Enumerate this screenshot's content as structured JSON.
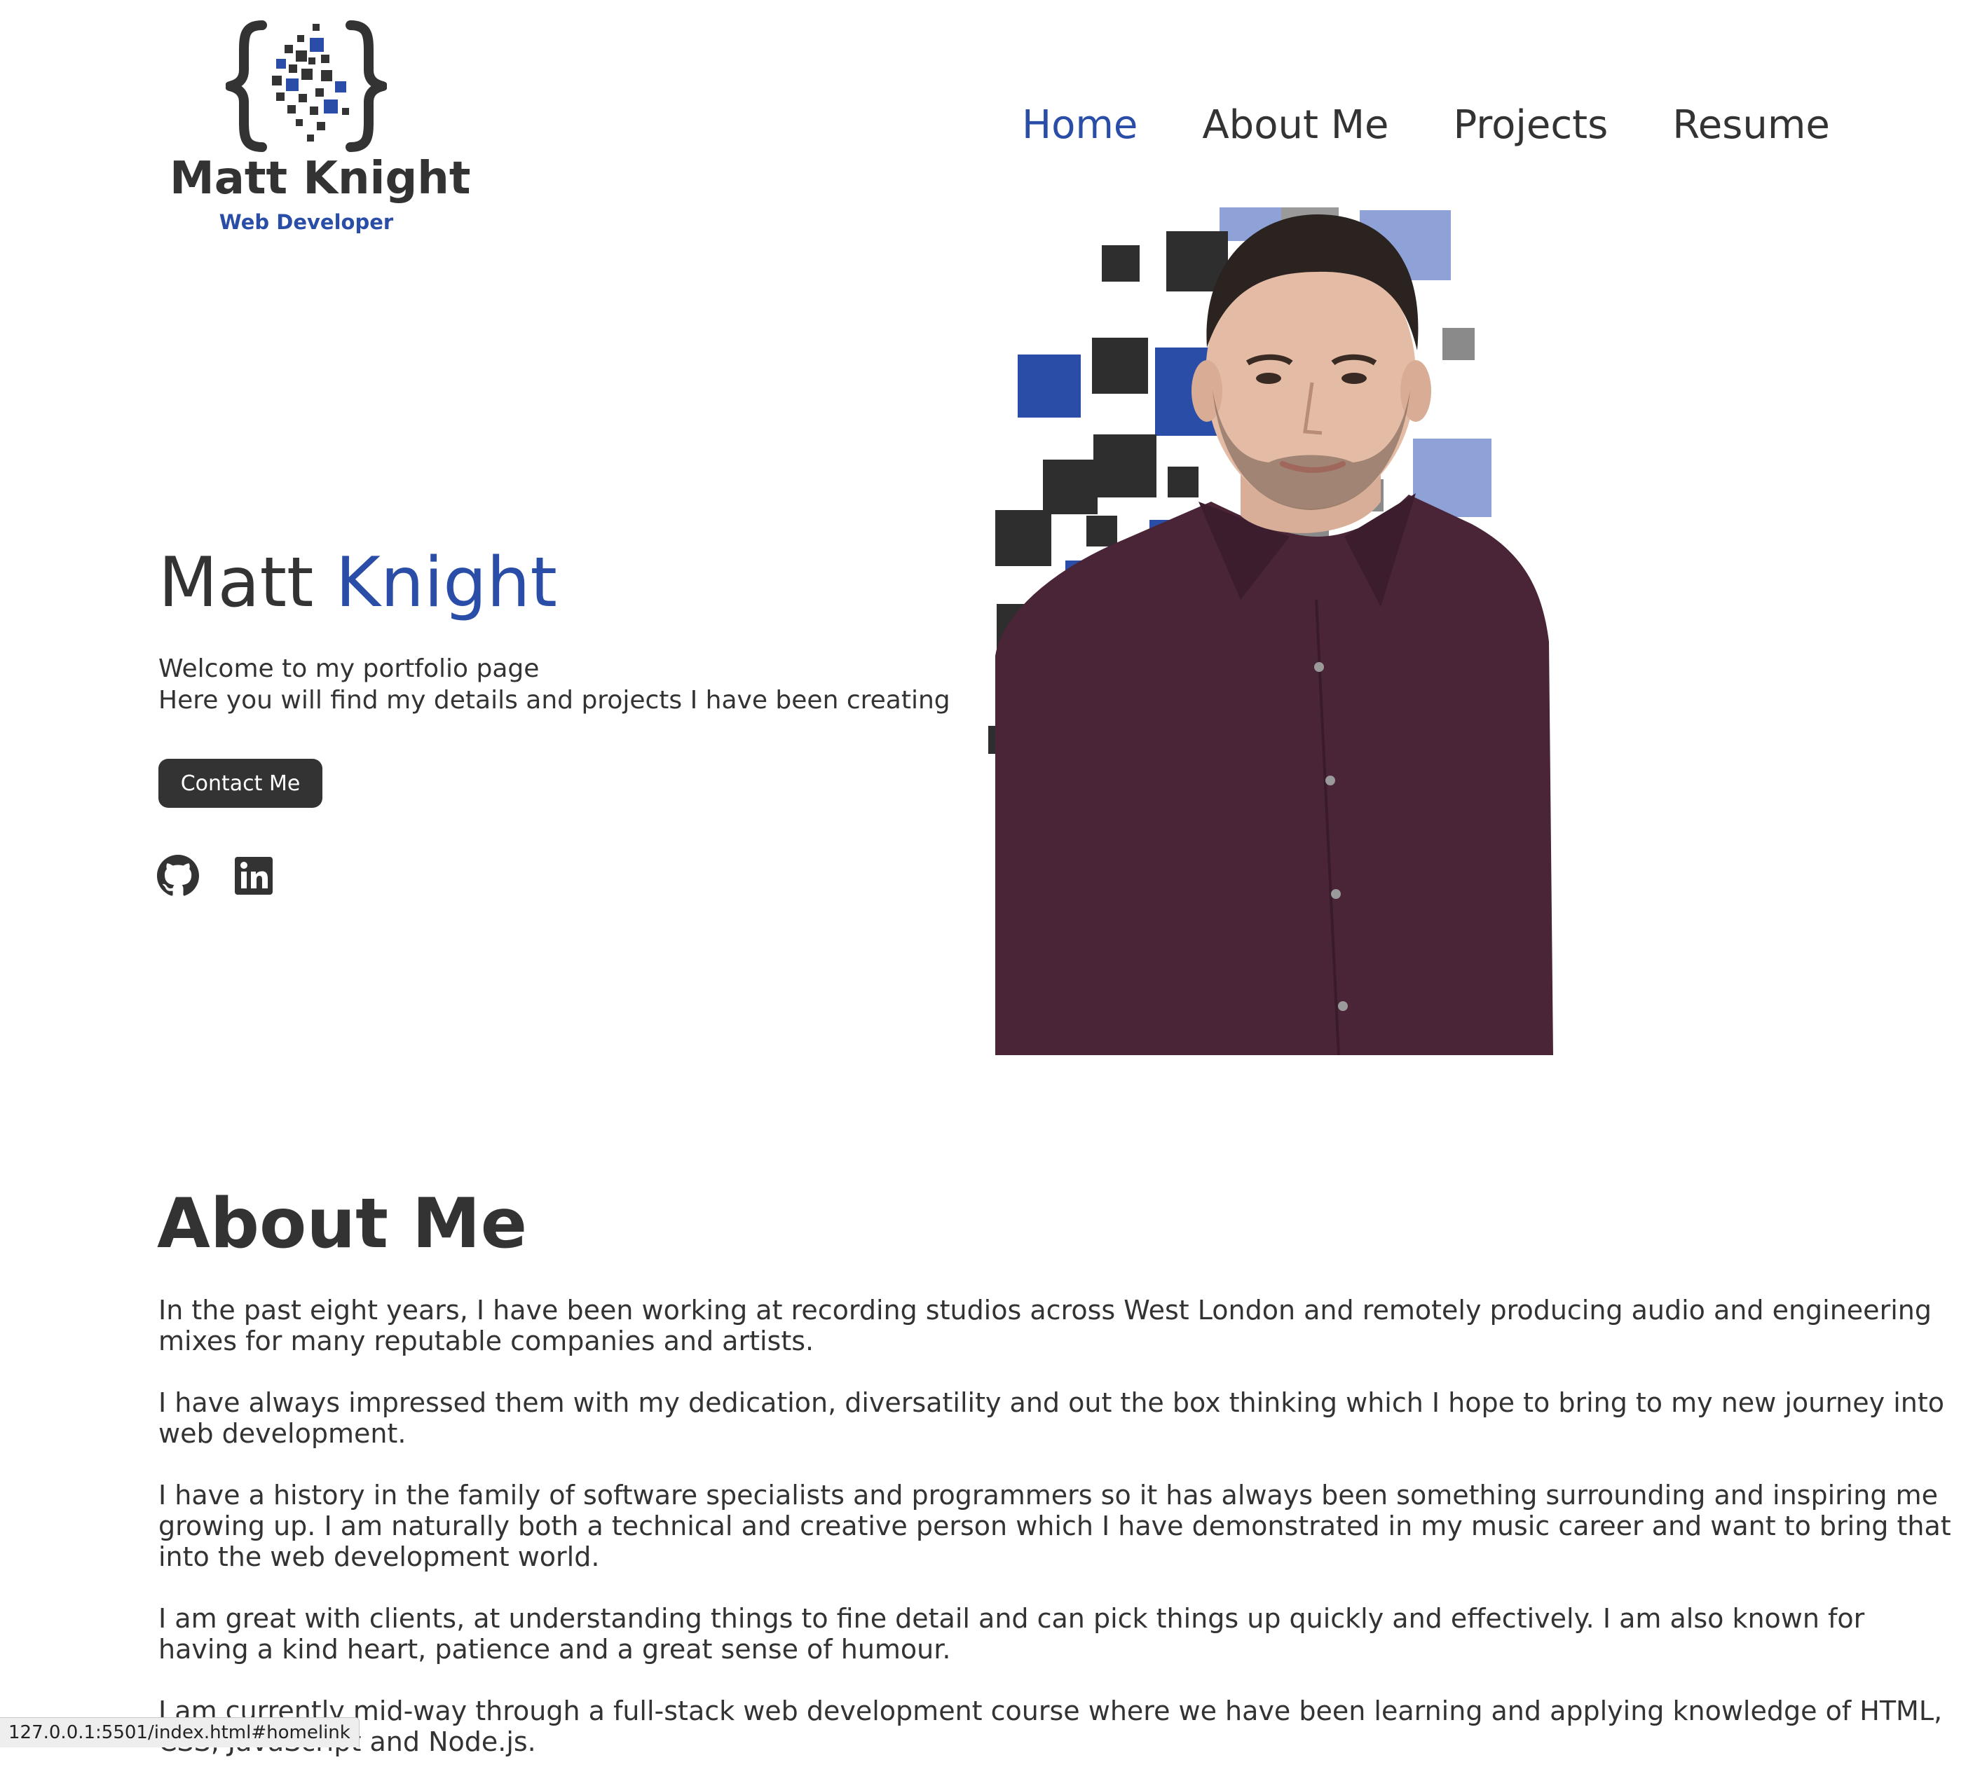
{
  "colors": {
    "text": "#333333",
    "accent": "#2a4ea8",
    "button_bg": "#333333",
    "button_text": "#ffffff",
    "shirt": "#4a2538"
  },
  "header": {
    "logo": {
      "name": "Matt Knight",
      "tagline": "Web Developer",
      "icon": "braces-pixel-logo-icon"
    },
    "nav": [
      {
        "label": "Home",
        "active": true
      },
      {
        "label": "About Me",
        "active": false
      },
      {
        "label": "Projects",
        "active": false
      },
      {
        "label": "Resume",
        "active": false
      }
    ]
  },
  "hero": {
    "first_name": "Matt",
    "last_name": "Knight",
    "line1": "Welcome to my portfolio page",
    "line2": "Here you will find my details and projects I have been creating",
    "button_label": "Contact Me",
    "social_icons": [
      "github-icon",
      "linkedin-icon"
    ],
    "portrait_icon": "portrait-photo"
  },
  "about": {
    "title": "About Me",
    "paragraphs": [
      "In the past eight years, I have been working at recording studios across West London and remotely producing audio and engineering mixes for many reputable companies and artists.",
      "I have always impressed them with my dedication, diversatility and out the box thinking which I hope to bring to my new journey into web development.",
      "I have a history in the family of software specialists and programmers so it has always been something surrounding and inspiring me growing up. I am naturally both a technical and creative person which I have demonstrated in my music career and want to bring that into the web development world.",
      "I am great with clients, at understanding things to fine detail and can pick things up quickly and effectively. I am also known for having a kind heart, patience and a great sense of humour.",
      "I am currently mid-way through a full-stack web development course where we have been learning and applying knowledge of HTML, CSS, JavaScript and Node.js."
    ]
  },
  "status_bar": {
    "url": "127.0.0.1:5501/index.html#homelink"
  }
}
